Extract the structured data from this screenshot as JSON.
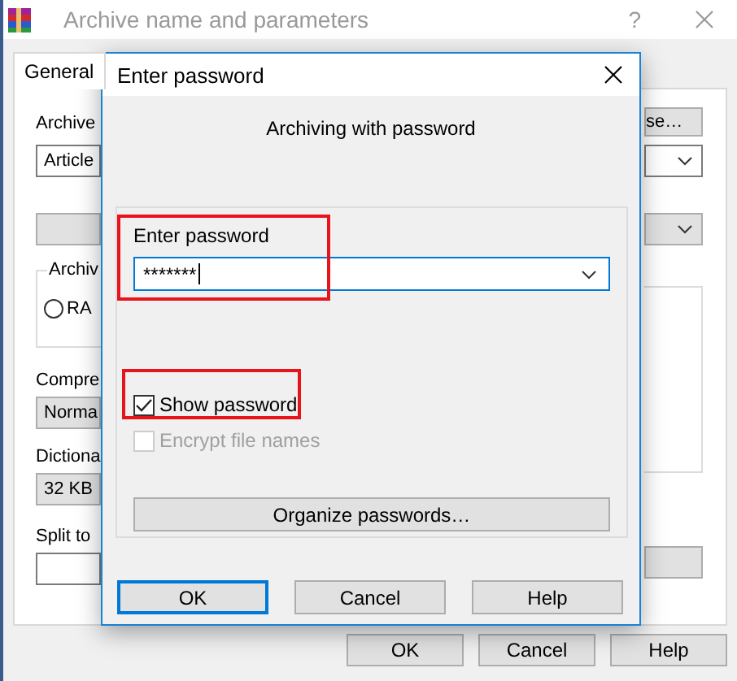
{
  "window": {
    "title": "Archive name and parameters",
    "help_button": "?"
  },
  "tabs": [
    {
      "label": "General",
      "selected": true
    }
  ],
  "general": {
    "archive_label": "Archive",
    "archive_field": "Article",
    "browse_button": "se…",
    "group_label": "Archiv",
    "radio": {
      "label": "RA",
      "selected": false
    },
    "compression_label": "Compre",
    "compression_value": "Norma",
    "dictionary_label": "Dictiona",
    "dictionary_value": "32 KB",
    "split_label": "Split to"
  },
  "buttons": [
    "OK",
    "Cancel",
    "Help"
  ],
  "dialog": {
    "title": "Enter password",
    "heading": "Archiving with password",
    "password_label": "Enter password",
    "password_value": "*******",
    "checkboxes": [
      {
        "label": "Show password",
        "checked": true,
        "disabled": false
      },
      {
        "label": "Encrypt file names",
        "checked": false,
        "disabled": true
      }
    ],
    "organize_button": "Organize passwords…",
    "buttons": [
      {
        "label": "OK",
        "default": true
      },
      {
        "label": "Cancel",
        "default": false
      },
      {
        "label": "Help",
        "default": false
      }
    ]
  }
}
